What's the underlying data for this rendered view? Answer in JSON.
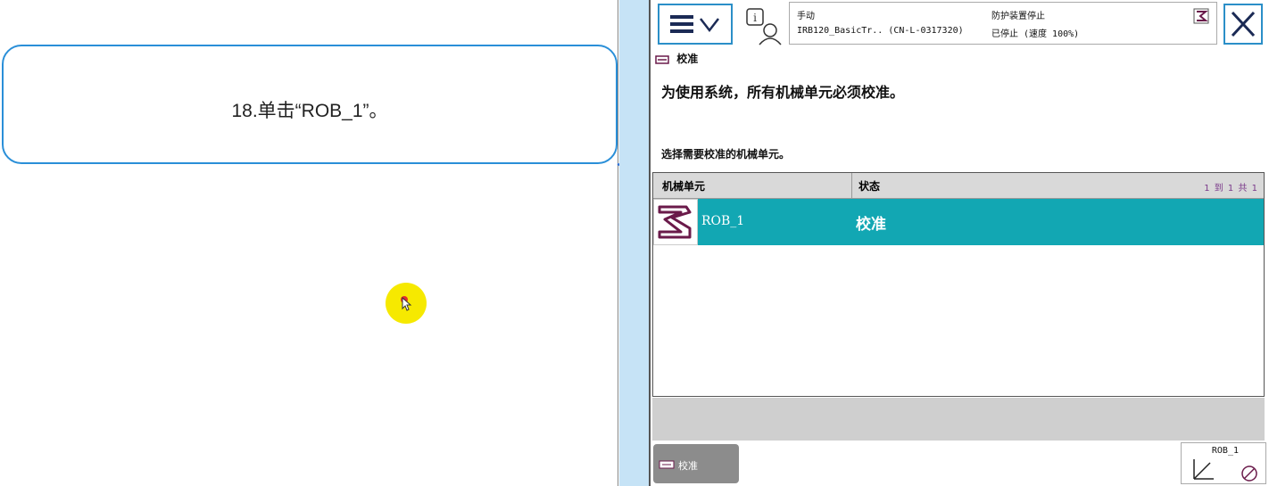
{
  "callout": {
    "text": "18.单击“ROB_1”。"
  },
  "header": {
    "mode": "手动",
    "system": "IRB120_BasicTr.. (CN-L-0317320)",
    "safety": "防护装置停止",
    "state": "已停止 (速度 100%)"
  },
  "screen": {
    "title": "校准",
    "instruction": "为使用系统，所有机械单元必须校准。",
    "subtitle": "选择需要校准的机械单元。"
  },
  "table": {
    "columns": [
      "机械单元",
      "状态"
    ],
    "count": "1 到 1 共 1",
    "rows": [
      {
        "unit": "ROB_1",
        "status": "校准"
      }
    ]
  },
  "footer": {
    "tab_label": "校准",
    "rob_label": "ROB_1"
  },
  "colors": {
    "accent": "#2b8fc8",
    "row_selected": "#12a7b3",
    "callout_border": "#2a8fd8",
    "cursor": "#f6e900"
  }
}
